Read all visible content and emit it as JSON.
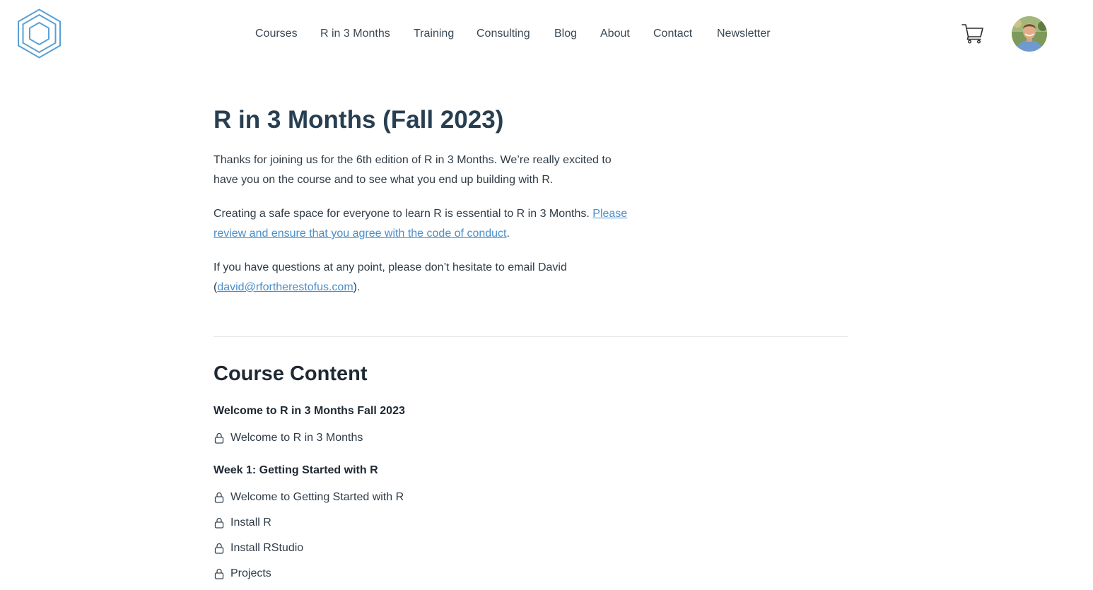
{
  "header": {
    "logo_icon": "hexagon-logo-icon",
    "brand_color": "#5a9fd4",
    "nav": [
      {
        "label": "Courses"
      },
      {
        "label": "R in 3 Months"
      },
      {
        "label": "Training"
      },
      {
        "label": "Consulting"
      },
      {
        "label": "Blog"
      },
      {
        "label": "About"
      },
      {
        "label": "Contact"
      },
      {
        "label": "Newsletter"
      }
    ],
    "cart_icon": "shopping-cart-icon",
    "avatar_icon": "user-avatar"
  },
  "main": {
    "title": "R in 3 Months (Fall 2023)",
    "intro": {
      "p1": "Thanks for joining us for the 6th edition of R in 3 Months. We’re really excited to have you on the course and to see what you end up building with R.",
      "p2_text": "Creating a safe space for everyone to learn R is essential to R in 3 Months. ",
      "p2_link": "Please review and ensure that you agree with the code of conduct",
      "p2_after": ".",
      "p3_text": "If you have questions at any point, please don’t hesitate to email David (",
      "p3_link": "david@rfortherestofus.com",
      "p3_after": ")."
    },
    "link_color": "#4a8fc9",
    "section_title": "Course Content",
    "modules": [
      {
        "title": "Welcome to R in 3 Months Fall 2023",
        "lessons": [
          {
            "label": "Welcome to R in 3 Months",
            "icon": "lock-icon"
          }
        ]
      },
      {
        "title": "Week 1: Getting Started with R",
        "lessons": [
          {
            "label": "Welcome to Getting Started with R",
            "icon": "lock-icon"
          },
          {
            "label": "Install R",
            "icon": "lock-icon"
          },
          {
            "label": "Install RStudio",
            "icon": "lock-icon"
          },
          {
            "label": "Projects",
            "icon": "lock-icon"
          }
        ]
      }
    ]
  }
}
